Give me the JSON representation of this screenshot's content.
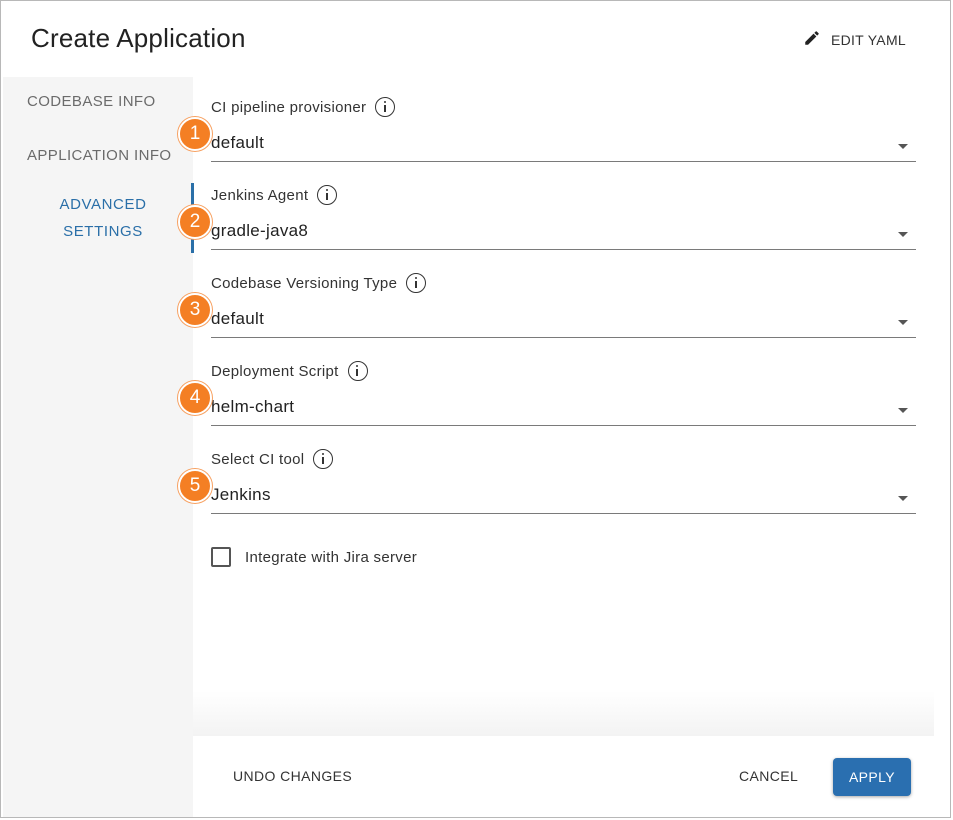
{
  "dialog": {
    "title": "Create Application",
    "edit_yaml_label": "EDIT YAML",
    "edit_yaml_icon": "pencil-icon"
  },
  "sidebar": {
    "items": [
      {
        "label": "CODEBASE INFO",
        "active": false
      },
      {
        "label": "APPLICATION INFO",
        "active": false
      },
      {
        "label_line1": "ADVANCED",
        "label_line2": "SETTINGS",
        "active": true
      }
    ]
  },
  "fields": [
    {
      "badge": "1",
      "label": "CI pipeline provisioner",
      "value": "default"
    },
    {
      "badge": "2",
      "label": "Jenkins Agent",
      "value": "gradle-java8"
    },
    {
      "badge": "3",
      "label": "Codebase Versioning Type",
      "value": "default"
    },
    {
      "badge": "4",
      "label": "Deployment Script",
      "value": "helm-chart"
    },
    {
      "badge": "5",
      "label": "Select CI tool",
      "value": "Jenkins"
    }
  ],
  "checkbox": {
    "label": "Integrate with Jira server",
    "checked": false
  },
  "footer": {
    "undo_label": "UNDO CHANGES",
    "cancel_label": "CANCEL",
    "apply_label": "APPLY"
  },
  "colors": {
    "accent": "#2a6fb0",
    "badge": "#f47f24",
    "sidebar_bg": "#f5f5f5"
  }
}
